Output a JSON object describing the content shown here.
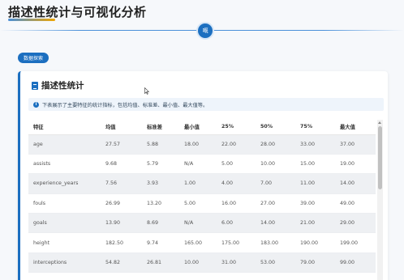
{
  "page": {
    "title": "描述性统计与可视化分析",
    "divider_badge": "嘅"
  },
  "tab_button": {
    "label": "数据探索"
  },
  "card": {
    "title": "描述性统计",
    "info": "下表展示了主要特征的统计指标，包括均值、标准差、最小值、最大值等。"
  },
  "table": {
    "headers": [
      "特征",
      "均值",
      "标准差",
      "最小值",
      "25%",
      "50%",
      "75%",
      "最大值"
    ],
    "rows": [
      [
        "age",
        "27.57",
        "5.88",
        "18.00",
        "22.00",
        "28.00",
        "33.00",
        "37.00"
      ],
      [
        "assists",
        "9.68",
        "5.79",
        "N/A",
        "5.00",
        "10.00",
        "15.00",
        "19.00"
      ],
      [
        "experience_years",
        "7.56",
        "3.93",
        "1.00",
        "4.00",
        "7.00",
        "11.00",
        "14.00"
      ],
      [
        "fouls",
        "26.99",
        "13.20",
        "5.00",
        "16.00",
        "27.00",
        "39.00",
        "49.00"
      ],
      [
        "goals",
        "13.90",
        "8.69",
        "N/A",
        "6.00",
        "14.00",
        "21.00",
        "29.00"
      ],
      [
        "height",
        "182.50",
        "9.74",
        "165.00",
        "175.00",
        "183.00",
        "190.00",
        "199.00"
      ],
      [
        "interceptions",
        "54.82",
        "26.81",
        "10.00",
        "31.00",
        "53.00",
        "79.00",
        "99.00"
      ],
      [
        "",
        "",
        "",
        "",
        "",
        "",
        "",
        ""
      ]
    ]
  },
  "colors": {
    "accent": "#1c6fc0",
    "row_alt": "#eef0f3",
    "info_bg": "#eef4fb"
  }
}
